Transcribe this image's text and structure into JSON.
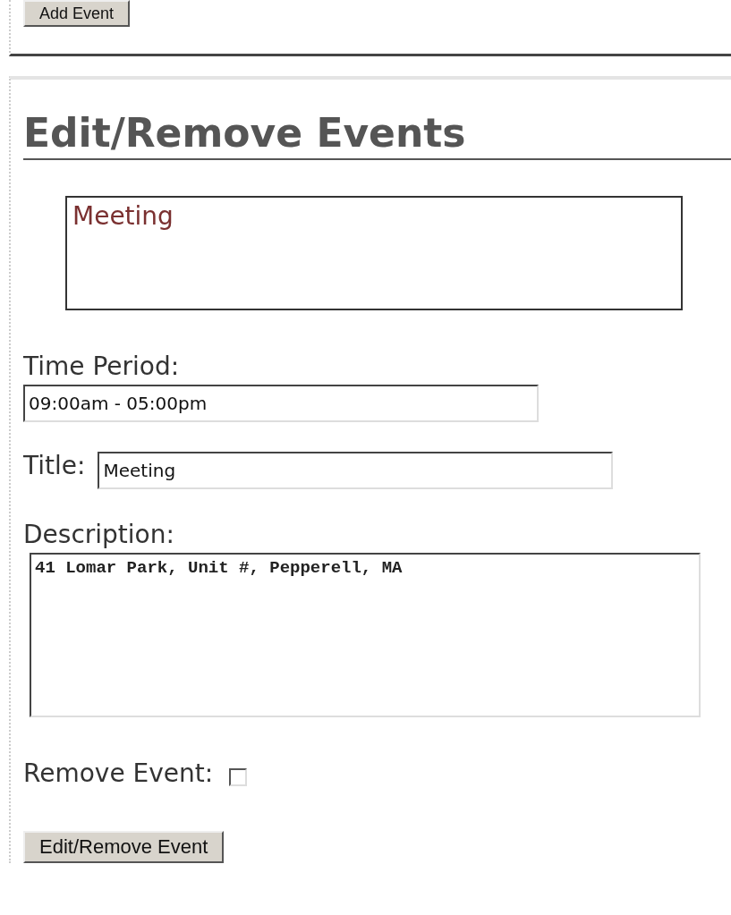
{
  "add_button": {
    "label": "Add Event"
  },
  "heading": "Edit/Remove Events",
  "event_list": {
    "items": [
      {
        "label": "Meeting",
        "selected": false
      }
    ]
  },
  "fields": [
    {
      "kind": "text",
      "label": "Time Period:",
      "value": "09:00am - 05:00pm"
    },
    {
      "kind": "inline",
      "label": "Title:",
      "value": "Meeting"
    },
    {
      "kind": "textarea",
      "label": "Description:",
      "value": "41 Lomar Park, Unit #, Pepperell, MA"
    },
    {
      "kind": "checkbox",
      "label": "Remove Event:",
      "checked": false
    }
  ],
  "submit_button": {
    "label": "Edit/Remove Event"
  }
}
